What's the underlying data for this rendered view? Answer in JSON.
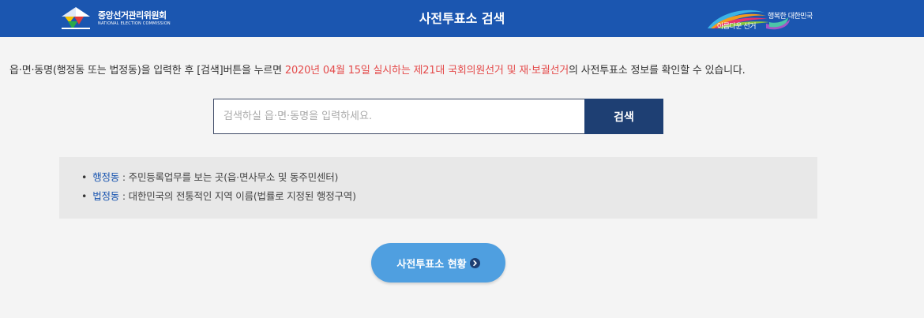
{
  "header": {
    "logo": {
      "name_ko": "중앙선거관리위원회",
      "name_en": "NATIONAL ELECTION COMMISSION"
    },
    "title": "사전투표소 검색",
    "slogan": {
      "line1": "아름다운 선거",
      "line2": "행복한 대한민국"
    },
    "color": "#1b56b0"
  },
  "intro": {
    "before": "읍·면·동명(행정동 또는 법정동)을 입력한 후 [검색]버튼을 누르면 ",
    "highlight": "2020년 04월 15일 실시하는 제21대 국회의원선거 및 재·보궐선거",
    "after": "의 사전투표소 정보를 확인할 수 있습니다.",
    "highlight_color": "#e44a4a"
  },
  "search": {
    "placeholder": "검색하실 읍·면·동명을 입력하세요.",
    "value": "",
    "button_label": "검색"
  },
  "info": {
    "items": [
      {
        "term": "행정동",
        "desc": " : 주민등록업무를 보는 곳(읍·면사무소 및 동주민센터)"
      },
      {
        "term": "법정동",
        "desc": " : 대한민국의 전통적인 지역 이름(법률로 지정된 행정구역)"
      }
    ]
  },
  "status_button": {
    "label": "사전투표소 현황",
    "icon": "chevron-right-circle-icon",
    "color": "#4f9fe0"
  }
}
